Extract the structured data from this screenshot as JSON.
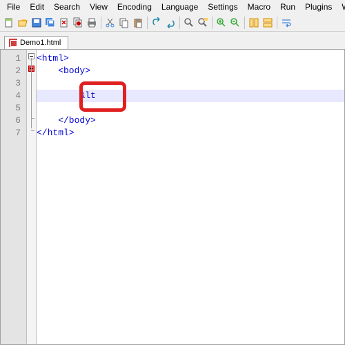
{
  "menu": {
    "file": "File",
    "edit": "Edit",
    "search": "Search",
    "view": "View",
    "encoding": "Encoding",
    "language": "Language",
    "settings": "Settings",
    "macro": "Macro",
    "run": "Run",
    "plugins": "Plugins",
    "window": "Win"
  },
  "tab": {
    "title": "Demo1.html"
  },
  "code": {
    "lines": [
      "1",
      "2",
      "3",
      "4",
      "5",
      "6",
      "7"
    ],
    "l1": "<html>",
    "l2": "    <body>",
    "l3": "",
    "l4": "        &lt",
    "l5": "",
    "l6": "    </body>",
    "l7": "</html>"
  },
  "colors": {
    "tag": "#0000d0",
    "highlight": "#e02020"
  }
}
